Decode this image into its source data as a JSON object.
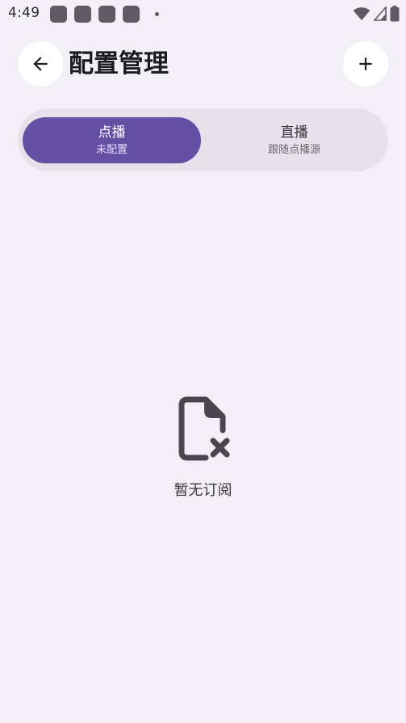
{
  "status_bar": {
    "time": "4:49"
  },
  "header": {
    "title": "配置管理"
  },
  "tabs": [
    {
      "label": "点播",
      "sublabel": "未配置",
      "selected": true
    },
    {
      "label": "直播",
      "sublabel": "跟随点播源",
      "selected": false
    }
  ],
  "empty_state": {
    "message": "暂无订阅"
  },
  "colors": {
    "background": "#F3EFF7",
    "accent": "#634FA3",
    "tab_track": "#E7E2EA",
    "icon": "#4A4650"
  },
  "icons": {
    "back": "arrow-back-icon",
    "add": "plus-icon",
    "empty": "file-remove-icon"
  }
}
